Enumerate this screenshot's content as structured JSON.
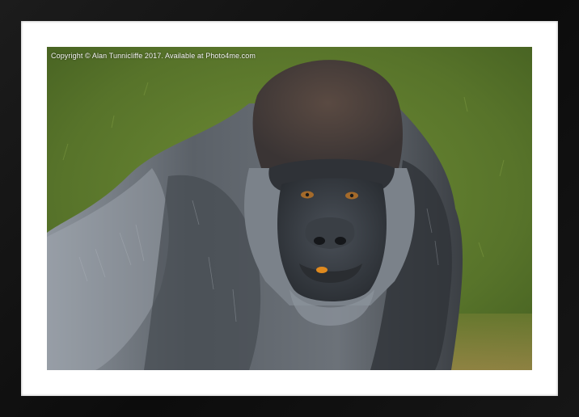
{
  "watermark": {
    "text": "Copyright  © Alan Tunnicliffe  2017. Available at Photo4me.com"
  },
  "subject": "gorilla portrait",
  "frame": {
    "outer_color": "#111111",
    "mount_color": "#ffffff"
  }
}
